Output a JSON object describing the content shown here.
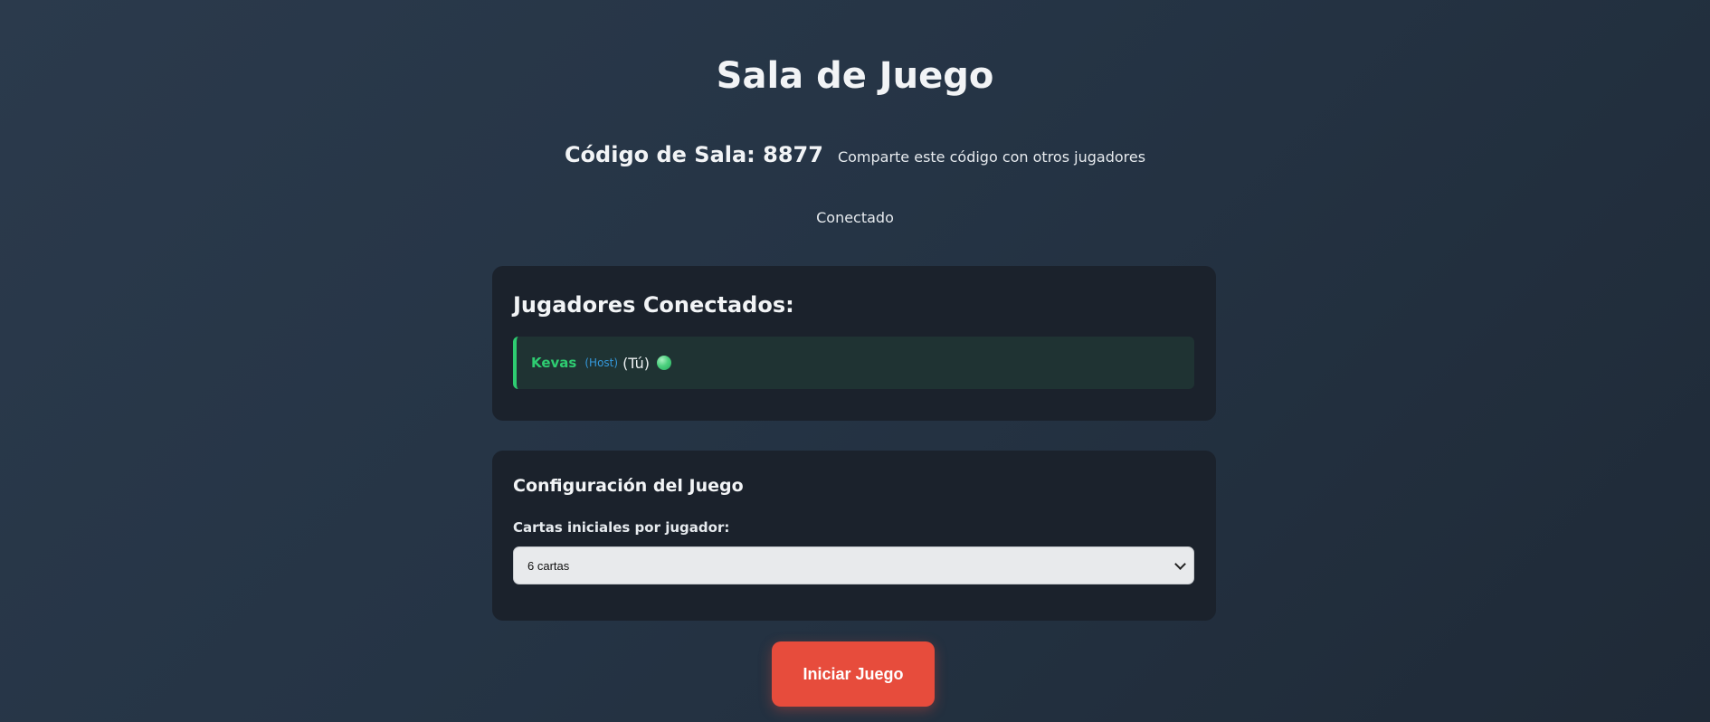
{
  "page": {
    "title": "Sala de Juego"
  },
  "room": {
    "code_label": "Código de Sala: 8877",
    "share_hint": "Comparte este código con otros jugadores"
  },
  "connection": {
    "status": "Conectado"
  },
  "players": {
    "heading": "Jugadores Conectados:",
    "items": [
      {
        "name": "Kevas",
        "badge": "(Host)",
        "self_label": "(Tú)",
        "status_icon": "online-dot-icon"
      }
    ]
  },
  "config": {
    "heading": "Configuración del Juego",
    "cards_label": "Cartas iniciales por jugador:",
    "cards_selected": "6 cartas"
  },
  "actions": {
    "start_label": "Iniciar Juego"
  },
  "colors": {
    "accent_green": "#2ecc71",
    "host_blue": "#3498db",
    "start_red": "#e74c3c",
    "panel_bg": "#1b222c"
  }
}
